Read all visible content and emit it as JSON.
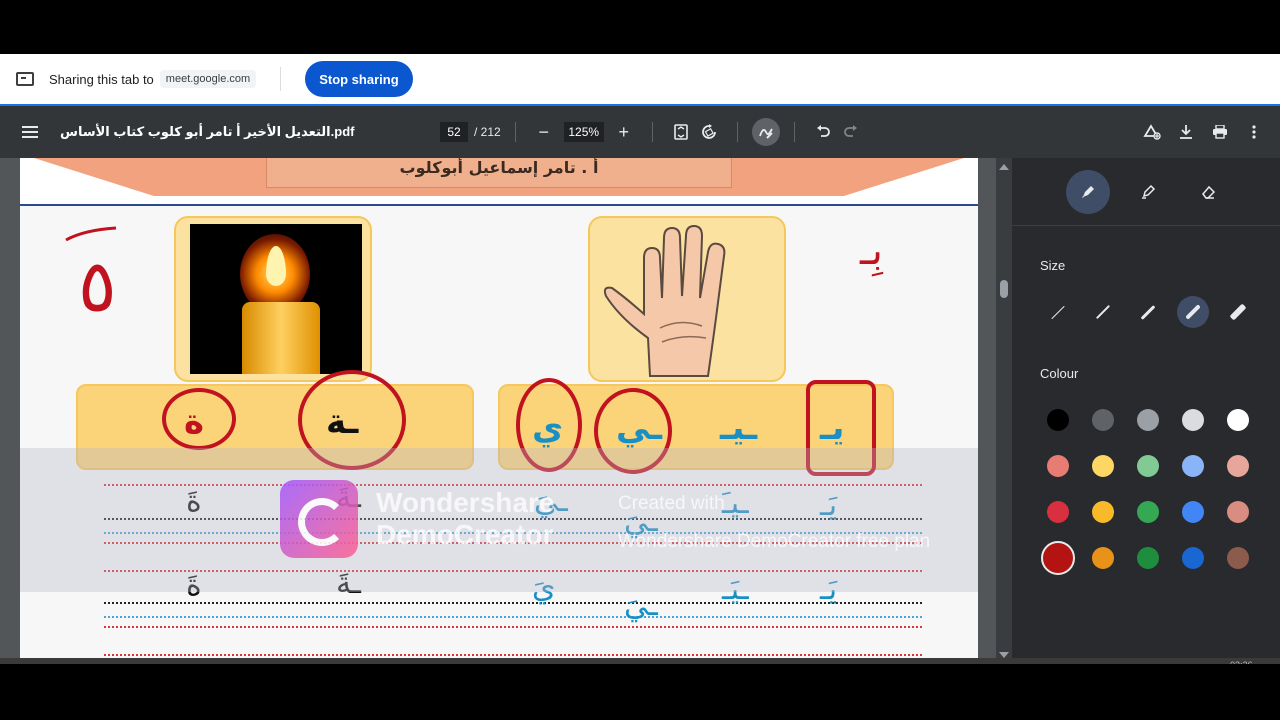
{
  "share_bar": {
    "text": "Sharing this tab to",
    "domain": "meet.google.com",
    "stop_label": "Stop sharing"
  },
  "toolbar": {
    "title": "التعديل الأخير أ تامر أبو كلوب كتاب الأساس.pdf",
    "page_current": "52",
    "page_total": "/ 212",
    "zoom": "125%",
    "zoom_out": "−",
    "zoom_in": "+"
  },
  "page": {
    "author": "أ . تامر إسماعيل أبوكلوب",
    "top_letters": [
      "ة",
      "ـة",
      "ي",
      "ـي",
      "ـيـ",
      "يـ"
    ],
    "handwritten_left": "٥",
    "handwritten_right": "بِـ",
    "practice_row_1": [
      "ةَ",
      "ـةَ",
      "ـيَ",
      "ـيَ",
      "ـيـَ",
      "يَـ"
    ],
    "practice_row_2": [
      "ةَ",
      "ـةَ",
      "يَ",
      "ـيَ",
      "ـيَـ",
      "يَـ"
    ]
  },
  "watermark": {
    "brand_line1": "Wondershare",
    "brand_line2": "DemoCreator",
    "created_line1": "Created with",
    "created_line2": "Wondershare DemoCreator free plan"
  },
  "side_panel": {
    "size_label": "Size",
    "colour_label": "Colour",
    "colors": [
      [
        "#000000",
        "#5f6368",
        "#9aa0a6",
        "#dadce0",
        "#ffffff"
      ],
      [
        "#e67c73",
        "#fdd663",
        "#81c995",
        "#8ab4f8",
        "#e6a69a"
      ],
      [
        "#d93040",
        "#f9ba29",
        "#34a853",
        "#4285f4",
        "#d98c80"
      ],
      [
        "#b31412",
        "#e8921a",
        "#1e8e3e",
        "#1967d2",
        "#8d5b4c"
      ]
    ]
  },
  "taskbar": {
    "time": "03:26"
  }
}
